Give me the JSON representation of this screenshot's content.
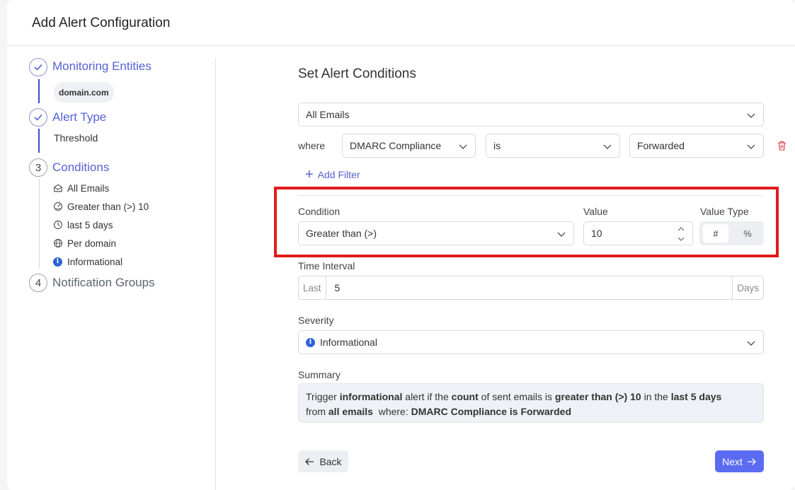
{
  "page": {
    "title": "Add Alert Configuration"
  },
  "stepper": {
    "steps": [
      {
        "number": "",
        "label": "Monitoring Entities",
        "state": "done"
      },
      {
        "number": "",
        "label": "Alert Type",
        "state": "done"
      },
      {
        "number": "3",
        "label": "Conditions",
        "state": "active"
      },
      {
        "number": "4",
        "label": "Notification Groups",
        "state": "pending"
      }
    ],
    "entity_chip": "domain.com",
    "alert_type_value": "Threshold",
    "condition_items": [
      {
        "icon": "envelope-open-icon",
        "label": "All Emails"
      },
      {
        "icon": "gauge-icon",
        "label": "Greater than (>) 10"
      },
      {
        "icon": "clock-icon",
        "label": "last 5 days"
      },
      {
        "icon": "globe-icon",
        "label": "Per domain"
      },
      {
        "icon": "info-icon",
        "label": "Informational"
      }
    ]
  },
  "conditions": {
    "title": "Set Alert Conditions",
    "scope_select": "All Emails",
    "where_label": "where",
    "filter": {
      "field": "DMARC Compliance",
      "operator": "is",
      "value": "Forwarded"
    },
    "add_filter_label": "Add Filter",
    "condition_label": "Condition",
    "condition_value": "Greater than (>)",
    "value_label": "Value",
    "value": "10",
    "value_type_label": "Value Type",
    "value_type_options": [
      "#",
      "%"
    ],
    "value_type_selected": "#",
    "time_interval_label": "Time Interval",
    "time_prefix": "Last",
    "time_value": "5",
    "time_suffix": "Days",
    "severity_label": "Severity",
    "severity_value": "Informational",
    "summary_label": "Summary",
    "summary": {
      "p1": "Trigger ",
      "b1": "informational",
      "p2": " alert if the ",
      "b2": "count",
      "p3": " of sent emails is ",
      "b3": "greater than (>) 10",
      "p4": " in the ",
      "b4": "last 5 days",
      "p5": " from ",
      "b5": "all emails",
      "p6": "  where: ",
      "b6": "DMARC Compliance is Forwarded"
    }
  },
  "actions": {
    "back_label": "Back",
    "next_label": "Next"
  },
  "colors": {
    "accent": "#5b6cf2",
    "highlight": "#e01b1b",
    "info": "#2c63d8"
  }
}
